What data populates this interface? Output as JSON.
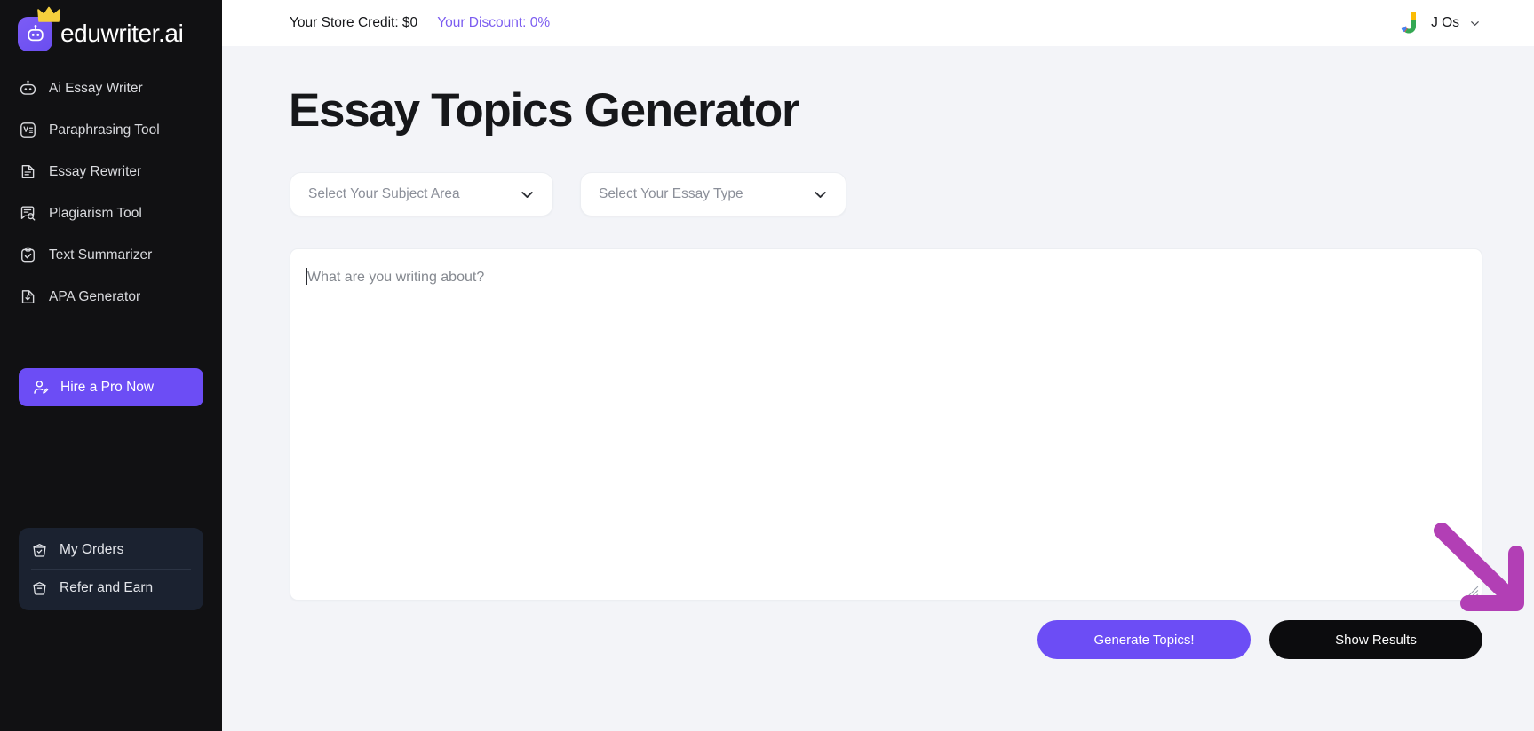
{
  "brand": {
    "name": "eduwriter.ai",
    "logo_icon": "robot-crown-logo",
    "accent": "#6c4df5"
  },
  "sidebar": {
    "items": [
      {
        "label": "Ai Essay Writer",
        "icon": "robot-icon"
      },
      {
        "label": "Paraphrasing Tool",
        "icon": "paraphrase-box-icon"
      },
      {
        "label": "Essay Rewriter",
        "icon": "document-lines-icon"
      },
      {
        "label": "Plagiarism Tool",
        "icon": "message-search-icon"
      },
      {
        "label": "Text Summarizer",
        "icon": "clipboard-check-icon"
      },
      {
        "label": "APA Generator",
        "icon": "file-download-icon"
      }
    ],
    "hire_button": {
      "label": "Hire a Pro Now",
      "icon": "user-edit-icon",
      "color": "#6c4df5"
    },
    "bottom_items": [
      {
        "label": "My Orders",
        "icon": "basket-check-icon"
      },
      {
        "label": "Refer and Earn",
        "icon": "basket-icon"
      }
    ]
  },
  "topbar": {
    "store_credit": "Your Store Credit: $0",
    "discount": "Your Discount: 0%",
    "discount_color": "#7b5cf0",
    "user_name": "J Os",
    "avatar_icon": "google-j-avatar",
    "chevron_icon": "chevron-down-icon"
  },
  "main": {
    "title": "Essay Topics Generator",
    "selects": [
      {
        "placeholder": "Select Your Subject Area",
        "icon": "chevron-down-icon"
      },
      {
        "placeholder": "Select Your Essay Type",
        "icon": "chevron-down-icon"
      }
    ],
    "editor": {
      "placeholder": "What are you writing about?",
      "value": ""
    },
    "buttons": {
      "generate": {
        "label": "Generate Topics!",
        "color": "#6c4df5"
      },
      "show_results": {
        "label": "Show Results",
        "color": "#0c0c0e"
      }
    },
    "annotation": {
      "icon": "arrow-down-right-icon",
      "color": "#b23fb5"
    }
  }
}
